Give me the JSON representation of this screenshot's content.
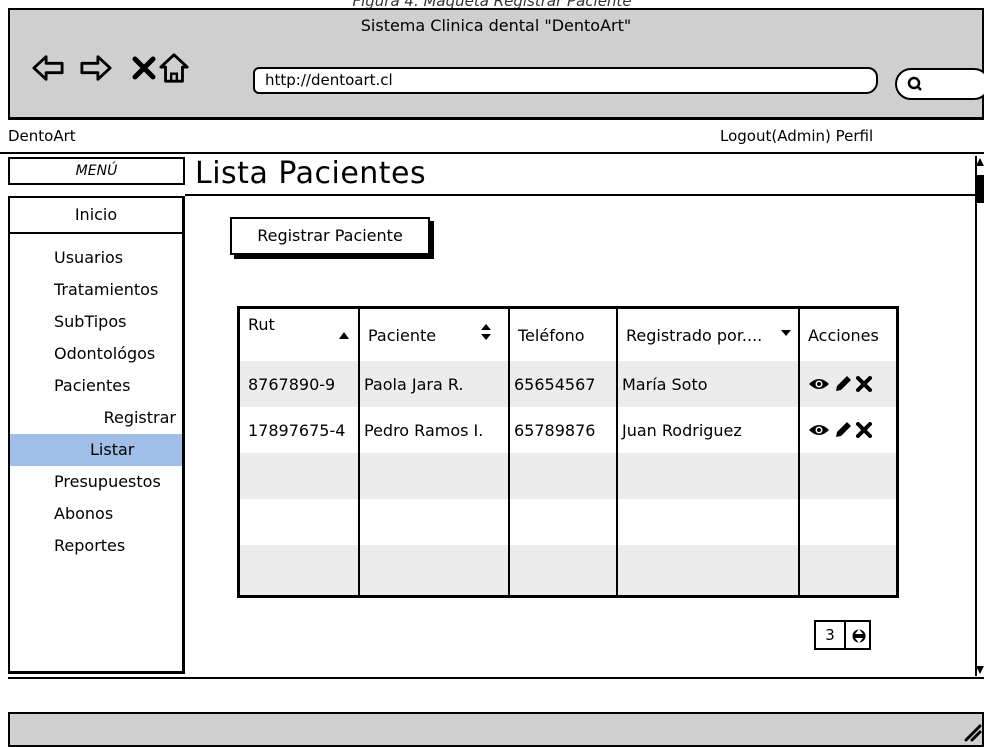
{
  "caption": "Figura 4.   Maqueta Registrar Paciente",
  "browser": {
    "title": "Sistema Clinica dental \"DentoArt\"",
    "url": "http://dentoart.cl"
  },
  "app": {
    "brand": "DentoArt",
    "topnav": "Logout(Admin) Perfil"
  },
  "sidebar": {
    "menu_title": "MENÚ",
    "home": "Inicio",
    "items": [
      {
        "label": "Usuarios"
      },
      {
        "label": "Tratamientos"
      },
      {
        "label": "SubTipos"
      },
      {
        "label": "Odontológos"
      },
      {
        "label": "Pacientes"
      },
      {
        "label": "Registrar"
      },
      {
        "label": "Listar"
      },
      {
        "label": "Presupuestos"
      },
      {
        "label": "Abonos"
      },
      {
        "label": "Reportes"
      }
    ]
  },
  "main": {
    "title": "Lista Pacientes",
    "register_button": "Registrar Paciente"
  },
  "table": {
    "headers": [
      "Rut",
      "Paciente",
      "Teléfono",
      "Registrado por....",
      "Acciones"
    ],
    "rows": [
      [
        "8767890-9",
        "Paola Jara R.",
        "65654567",
        "María Soto"
      ],
      [
        "17897675-4",
        "Pedro Ramos I.",
        "65789876",
        "Juan Rodriguez"
      ]
    ]
  },
  "pager": {
    "value": "3"
  }
}
